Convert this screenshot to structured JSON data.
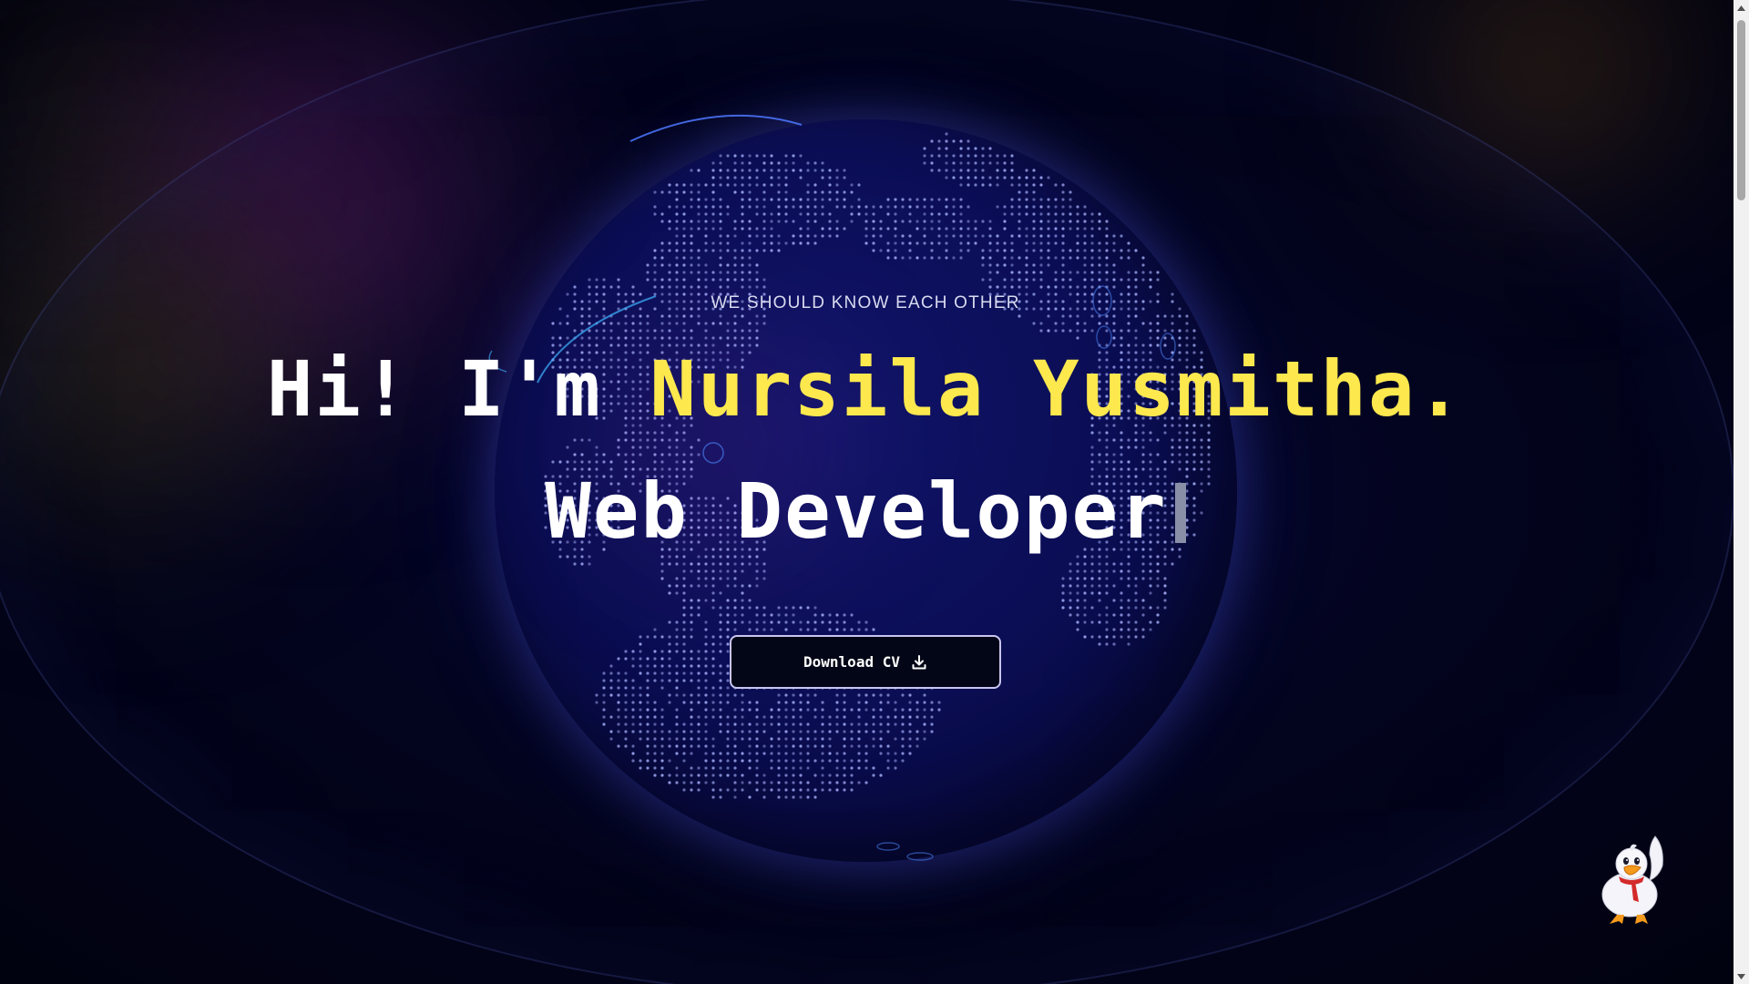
{
  "hero": {
    "eyebrow": "WE SHOULD KNOW EACH OTHER",
    "greeting": "Hi! I'm ",
    "name": "Nursila Yusmitha.",
    "role": "Web Developer"
  },
  "cta": {
    "label": "Download CV",
    "icon": "download-icon"
  },
  "colors": {
    "accent": "#fde84e",
    "background": "#02031a",
    "globe": "#0b0e55"
  },
  "mascot": {
    "icon": "duck-mascot-icon"
  }
}
